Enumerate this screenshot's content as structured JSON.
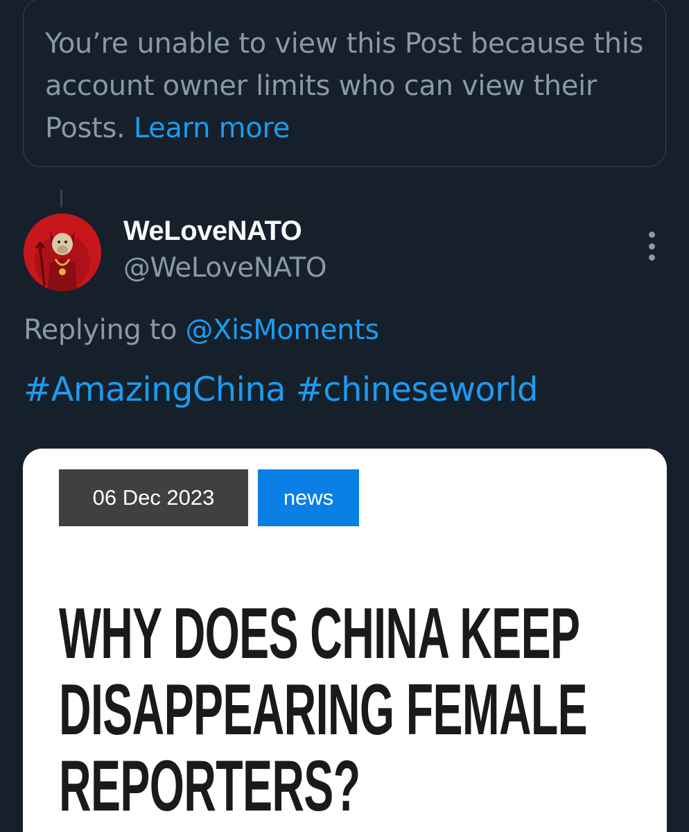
{
  "notice": {
    "text": "You’re unable to view this Post because this account owner limits who can view their Posts.",
    "link_label": "Learn more"
  },
  "post": {
    "display_name": "WeLoveNATO",
    "handle": "@WeLoveNATO",
    "replying_prefix": "Replying to",
    "replying_to": "@XisMoments",
    "hashtags": [
      "#AmazingChina",
      "#chineseworld"
    ],
    "more_icon": "more-vertical-icon"
  },
  "card": {
    "date": "06 Dec 2023",
    "category": "news",
    "headline_lines": [
      "WHY DOES CHINA KEEP",
      "DISAPPEARING FEMALE",
      "REPORTERS?"
    ]
  },
  "colors": {
    "background": "#15202b",
    "accent": "#1d9bf0",
    "muted": "#8b98a5",
    "date_badge": "#404040",
    "category_badge": "#0a7fe5"
  }
}
